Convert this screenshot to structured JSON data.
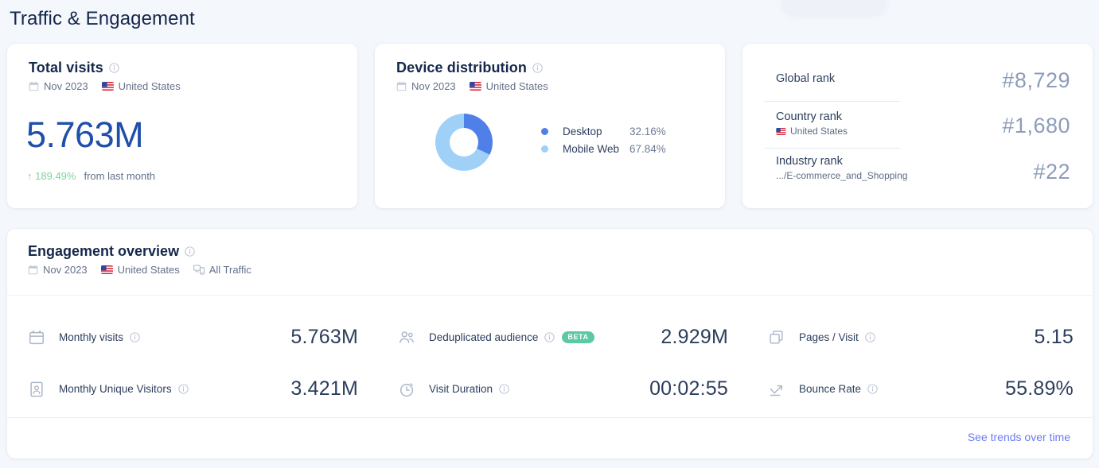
{
  "page": {
    "title": "Traffic & Engagement"
  },
  "colors": {
    "background": "#f4f7fc",
    "card": "#ffffff",
    "accent_blue": "#1f4fa8",
    "link": "#6b7bf3",
    "positive_green": "#7ed39a",
    "badge_green": "#5bc9a1",
    "desktop_blue": "#4f80e8",
    "mobile_blue": "#9fd0f8",
    "muted_text": "#63718a",
    "rank_value": "#8d9cba"
  },
  "total_visits": {
    "title": "Total visits",
    "info_icon": "info-icon",
    "calendar_icon": "calendar-icon",
    "period": "Nov 2023",
    "flag_icon": "us-flag-icon",
    "country": "United States",
    "value": "5.763M",
    "delta_arrow": "↑",
    "delta": "189.49%",
    "delta_note": "from last month"
  },
  "device_distribution": {
    "title": "Device distribution",
    "info_icon": "info-icon",
    "calendar_icon": "calendar-icon",
    "period": "Nov 2023",
    "flag_icon": "us-flag-icon",
    "country": "United States",
    "legend": [
      {
        "label": "Desktop",
        "value": "32.16%",
        "color": "#4f80e8"
      },
      {
        "label": "Mobile Web",
        "value": "67.84%",
        "color": "#9fd0f8"
      }
    ]
  },
  "chart_data": {
    "type": "pie",
    "title": "Device distribution",
    "categories": [
      "Desktop",
      "Mobile Web"
    ],
    "values": [
      32.16,
      67.84
    ],
    "unit": "%",
    "colors": [
      "#4f80e8",
      "#9fd0f8"
    ],
    "donut": true,
    "inner_radius_ratio": 0.5,
    "start_angle_deg": 0,
    "direction": "clockwise",
    "legend_position": "right",
    "grid": false
  },
  "ranks": [
    {
      "label": "Global rank",
      "sub": "",
      "sub_flag": "",
      "value": "#8,729"
    },
    {
      "label": "Country rank",
      "sub": "United States",
      "sub_flag": "us-flag-icon",
      "value": "#1,680"
    },
    {
      "label": "Industry rank",
      "sub": ".../E-commerce_and_Shopping",
      "sub_flag": "",
      "value": "#22"
    }
  ],
  "engagement": {
    "title": "Engagement overview",
    "info_icon": "info-icon",
    "calendar_icon": "calendar-icon",
    "period": "Nov 2023",
    "flag_icon": "us-flag-icon",
    "country": "United States",
    "devices_icon": "devices-icon",
    "traffic_filter": "All Traffic",
    "metrics": [
      {
        "icon": "calendar-icon",
        "label": "Monthly visits",
        "value": "5.763M",
        "badge": ""
      },
      {
        "icon": "people-icon",
        "label": "Deduplicated audience",
        "value": "2.929M",
        "badge": "BETA"
      },
      {
        "icon": "pages-icon",
        "label": "Pages / Visit",
        "value": "5.15",
        "badge": ""
      },
      {
        "icon": "visitor-icon",
        "label": "Monthly Unique Visitors",
        "value": "3.421M",
        "badge": ""
      },
      {
        "icon": "stopwatch-icon",
        "label": "Visit Duration",
        "value": "00:02:55",
        "badge": ""
      },
      {
        "icon": "bounce-icon",
        "label": "Bounce Rate",
        "value": "55.89%",
        "badge": ""
      }
    ],
    "trends_link": "See trends over time"
  }
}
